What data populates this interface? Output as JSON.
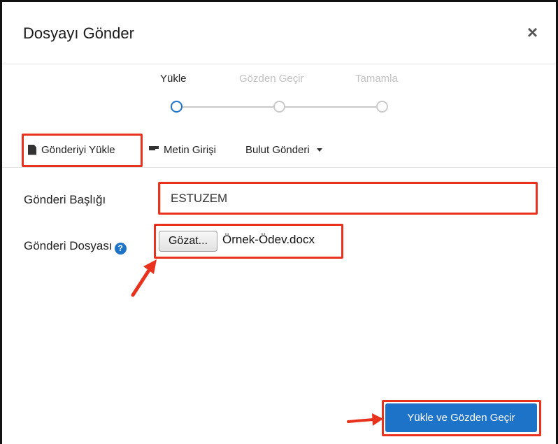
{
  "dialog": {
    "title": "Dosyayı Gönder",
    "close_label": "×"
  },
  "steps": [
    {
      "label": "Yükle",
      "state": "active"
    },
    {
      "label": "Gözden Geçir",
      "state": "inactive"
    },
    {
      "label": "Tamamla",
      "state": "inactive"
    }
  ],
  "tabs": {
    "upload": {
      "label": "Gönderiyi Yükle",
      "icon": "document-icon"
    },
    "text": {
      "label": "Metin Girişi",
      "icon": "lines-icon"
    },
    "cloud": {
      "label": "Bulut Gönderi",
      "icon": "caret-down-icon"
    }
  },
  "form": {
    "title_label": "Gönderi Başlığı",
    "title_value": "ESTUZEM",
    "file_label": "Gönderi Dosyası",
    "help_glyph": "?",
    "browse_label": "Gözat...",
    "file_name": "Örnek-Ödev.docx"
  },
  "actions": {
    "submit_label": "Yükle ve Gözden Geçir"
  },
  "colors": {
    "accent": "#1c73c8",
    "highlight": "#e8321d"
  }
}
